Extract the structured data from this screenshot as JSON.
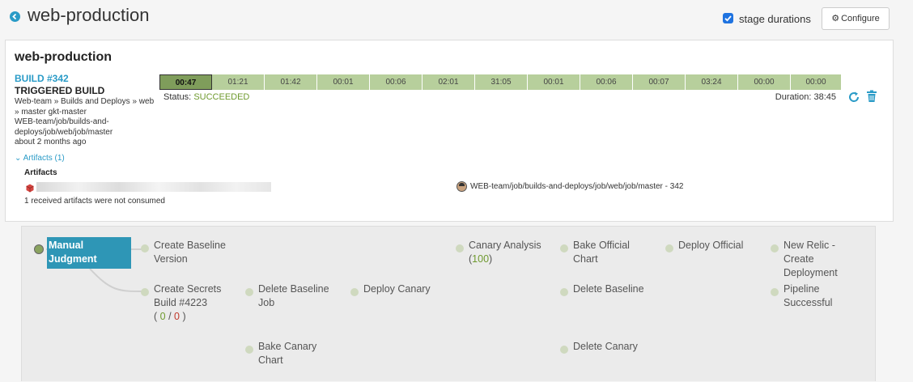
{
  "header": {
    "title": "web-production",
    "stage_durations_label": "stage durations",
    "stage_durations_checked": true,
    "configure_label": "Configure",
    "accent_color": "#2a9bc7"
  },
  "execution": {
    "title": "web-production",
    "build_number": "BUILD #342",
    "trigger": "TRIGGERED BUILD",
    "info_lines": [
      "Web-team » Builds and Deploys » web",
      "» master gkt-master",
      "WEB-team/job/builds-and-",
      "deploys/job/web/job/master",
      "about 2 months ago"
    ],
    "stage_durations": [
      "00:47",
      "01:21",
      "01:42",
      "00:01",
      "00:06",
      "02:01",
      "31:05",
      "00:01",
      "00:06",
      "00:07",
      "03:24",
      "00:00",
      "00:00"
    ],
    "active_stage_index": 0,
    "status_label": "Status:",
    "status_value": "SUCCEEDED",
    "duration": "Duration: 38:45",
    "artifacts_toggle": "Artifacts (1)",
    "artifacts_heading": "Artifacts",
    "artifacts_note": "1 received artifacts were not consumed",
    "jenkins_job": "WEB-team/job/builds-and-deploys/job/web/job/master - 342",
    "success_color": "#6f9a2f"
  },
  "pipeline": {
    "manual_judgment": [
      "Manual",
      "Judgment"
    ],
    "nodes": {
      "create_baseline_version": [
        "Create Baseline",
        "Version"
      ],
      "create_secrets": [
        "Create Secrets",
        "Build #4223"
      ],
      "create_secrets_counts": {
        "open": "( ",
        "ok": "0",
        "sep": " / ",
        "bad": "0",
        "close": " )"
      },
      "delete_baseline_job": [
        "Delete Baseline",
        "Job"
      ],
      "deploy_canary": [
        "Deploy Canary"
      ],
      "bake_canary_chart": [
        "Bake Canary",
        "Chart"
      ],
      "canary_analysis": [
        "Canary Analysis"
      ],
      "canary_analysis_score": {
        "open": "(",
        "value": "100",
        "close": ")"
      },
      "bake_official_chart": [
        "Bake Official",
        "Chart"
      ],
      "delete_baseline": [
        "Delete Baseline"
      ],
      "delete_canary": [
        "Delete Canary"
      ],
      "deploy_official": [
        "Deploy Official"
      ],
      "new_relic": [
        "New Relic -",
        "Create",
        "Deployment"
      ],
      "pipeline_successful": [
        "Pipeline",
        "Successful"
      ]
    }
  }
}
